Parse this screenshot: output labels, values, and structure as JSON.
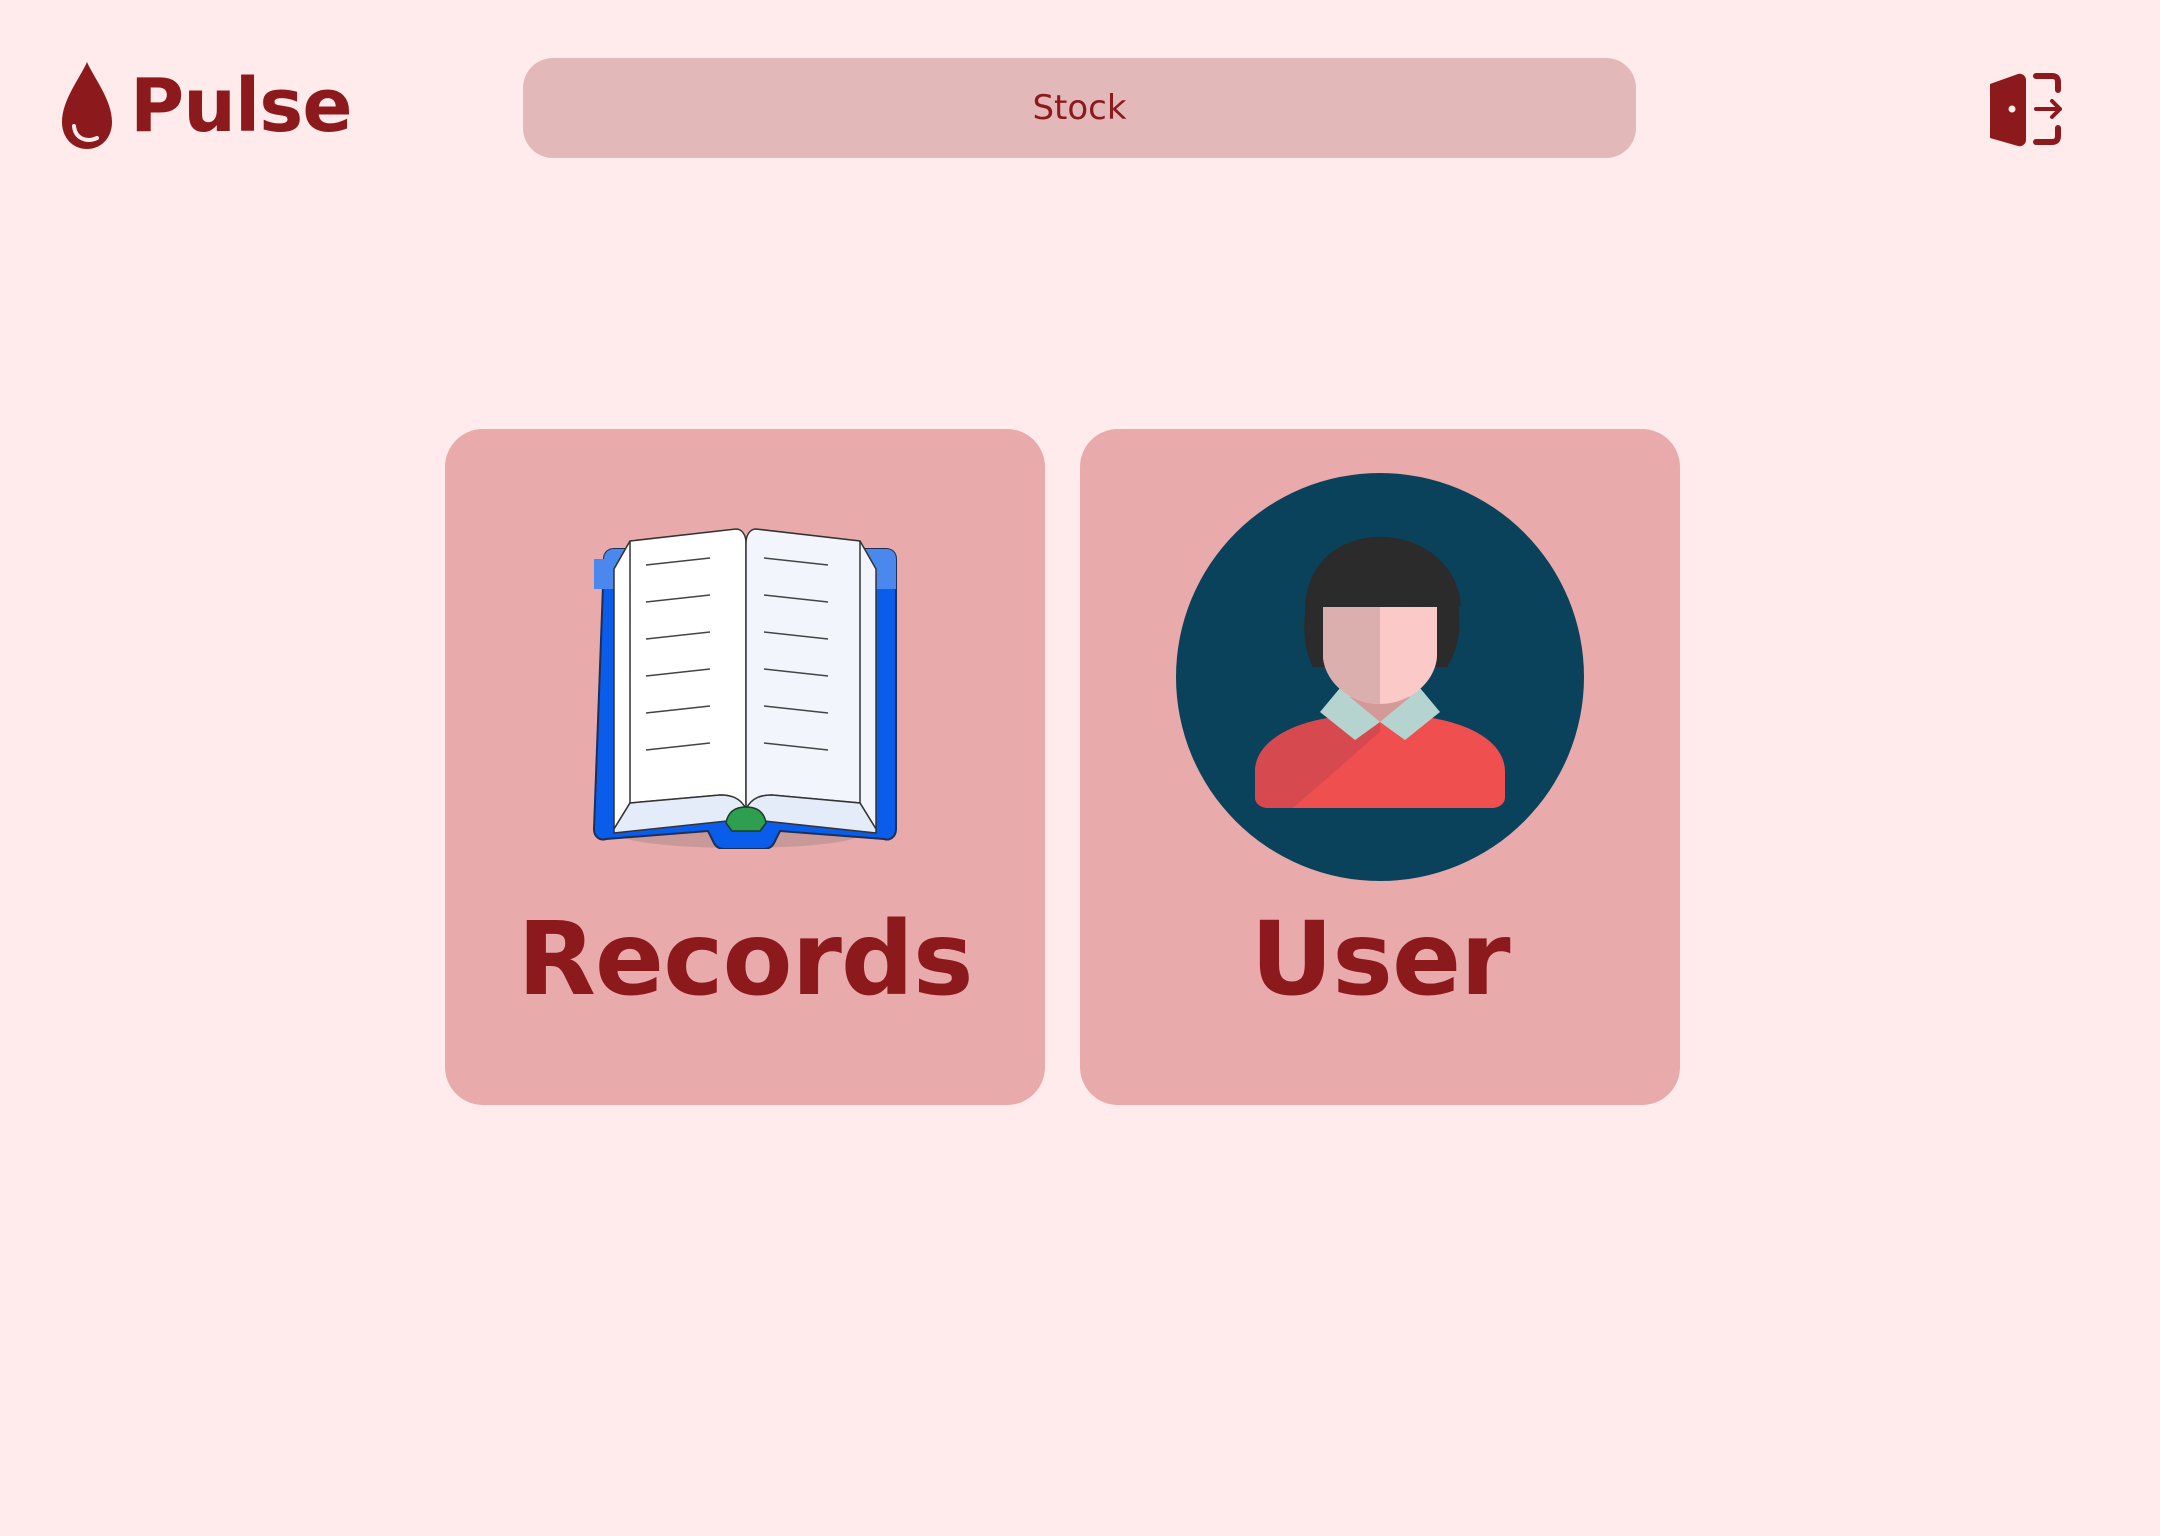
{
  "brand": {
    "name": "Pulse",
    "icon": "blood-drop-icon",
    "color": "#8C1A1D"
  },
  "header": {
    "stock_label": "Stock",
    "logout_icon": "logout-door-icon"
  },
  "cards": [
    {
      "label": "Records",
      "icon": "open-book-icon"
    },
    {
      "label": "User",
      "icon": "user-avatar-icon"
    }
  ],
  "colors": {
    "background": "#FFEBEB",
    "card": "#E8AAAA",
    "stock_button": "#E3B8B8",
    "accent": "#8C1A1D",
    "avatar_circle": "#0A425B"
  }
}
